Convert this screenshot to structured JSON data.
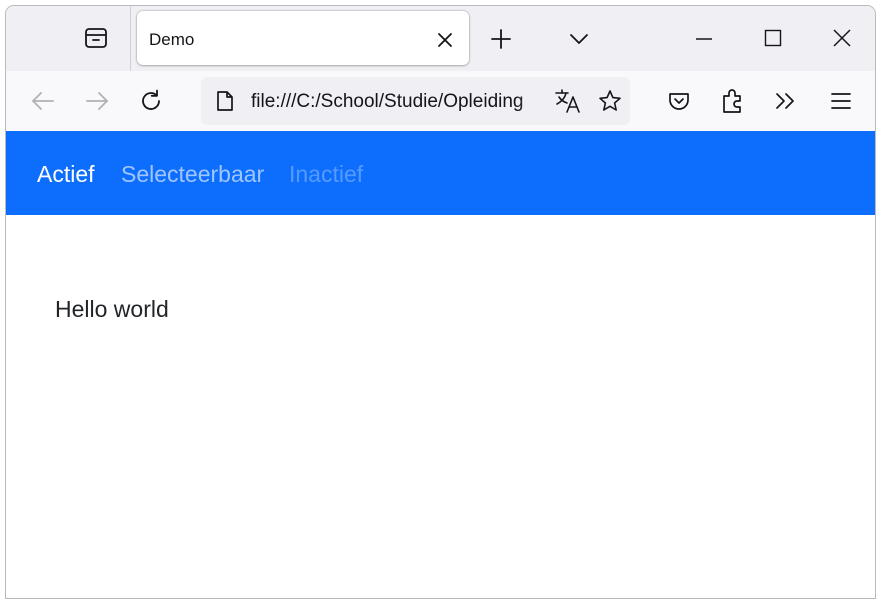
{
  "browser": {
    "tab": {
      "title": "Demo"
    },
    "urlbar": {
      "url": "file:///C:/School/Studie/Opleiding"
    },
    "icons": {
      "tab_manager": "archive-box-icon",
      "close_tab": "close-icon",
      "new_tab": "plus-icon",
      "list_tabs": "chevron-down-icon",
      "minimize": "minimize-icon",
      "maximize": "maximize-icon",
      "close_window": "close-icon",
      "back": "arrow-left-icon",
      "forward": "arrow-right-icon",
      "reload": "reload-icon",
      "page_info": "document-icon",
      "translate": "translate-icon",
      "bookmark": "star-icon",
      "pocket": "pocket-icon",
      "extensions": "puzzle-icon",
      "overflow": "double-chevron-icon",
      "menu": "hamburger-icon"
    }
  },
  "page": {
    "nav": {
      "items": [
        {
          "label": "Actief",
          "state": "active"
        },
        {
          "label": "Selecteerbaar",
          "state": "enabled"
        },
        {
          "label": "Inactief",
          "state": "disabled"
        }
      ],
      "background_color": "#0d6efd"
    },
    "main": {
      "text": "Hello world"
    }
  }
}
